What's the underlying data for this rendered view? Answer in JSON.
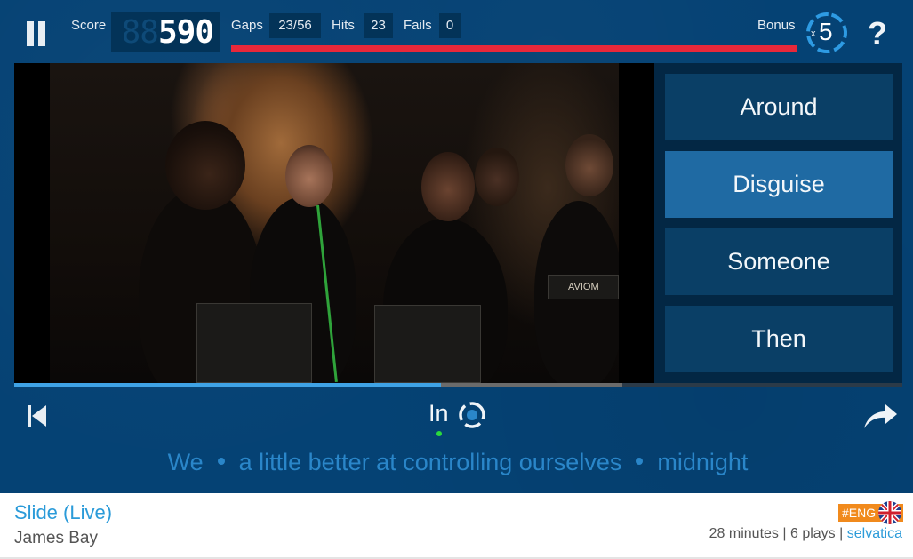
{
  "topbar": {
    "score_label": "Score",
    "score_ghost": "88",
    "score_value": "590",
    "gaps_label": "Gaps",
    "gaps_value": "23/56",
    "hits_label": "Hits",
    "hits_value": "23",
    "fails_label": "Fails",
    "fails_value": "0",
    "bonus_label": "Bonus",
    "bonus_prefix": "x",
    "bonus_value": "5",
    "help_label": "?",
    "time_remaining_color": "#e8283a"
  },
  "video": {
    "progress_played_fraction": 0.48,
    "progress_buffered_fraction": 0.685,
    "played_color": "#3fa3e6"
  },
  "options": [
    {
      "label": "Around",
      "selected": false
    },
    {
      "label": "Disguise",
      "selected": true
    },
    {
      "label": "Someone",
      "selected": false
    },
    {
      "label": "Then",
      "selected": false
    }
  ],
  "controls": {
    "current_word": "In",
    "prev_icon": "skip-previous-icon",
    "share_icon": "share-arrow-icon"
  },
  "lyrics": {
    "segments": [
      "We",
      "a little better at controlling ourselves",
      "midnight"
    ]
  },
  "footer": {
    "song_title": "Slide (Live)",
    "artist": "James Bay",
    "language_tag": "#ENG",
    "flag_icon": "uk-flag-icon",
    "duration": "28 minutes",
    "plays": "6 plays",
    "separator": "|",
    "user": "selvatica"
  }
}
